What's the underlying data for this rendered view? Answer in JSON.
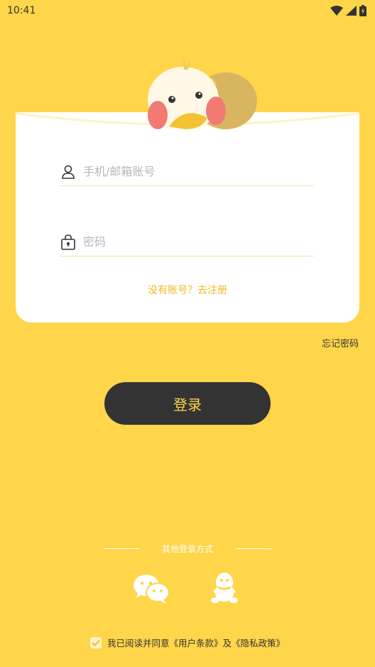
{
  "status_bar": {
    "time": "10:41"
  },
  "login": {
    "username_placeholder": "手机/邮箱账号",
    "password_placeholder": "密码",
    "register_text": "没有账号？去注册",
    "forgot_text": "忘记密码",
    "login_button": "登录"
  },
  "other_login": {
    "title": "其他登录方式",
    "icons": [
      "wechat-icon",
      "qq-icon"
    ]
  },
  "agreement": {
    "prefix": "我已阅读并同意",
    "terms": "《用户条款》",
    "conjunction": "及",
    "privacy": "《隐私政策》",
    "checked": true
  },
  "colors": {
    "background": "#FFD54A",
    "accent": "#F2B824",
    "button": "#333333"
  }
}
